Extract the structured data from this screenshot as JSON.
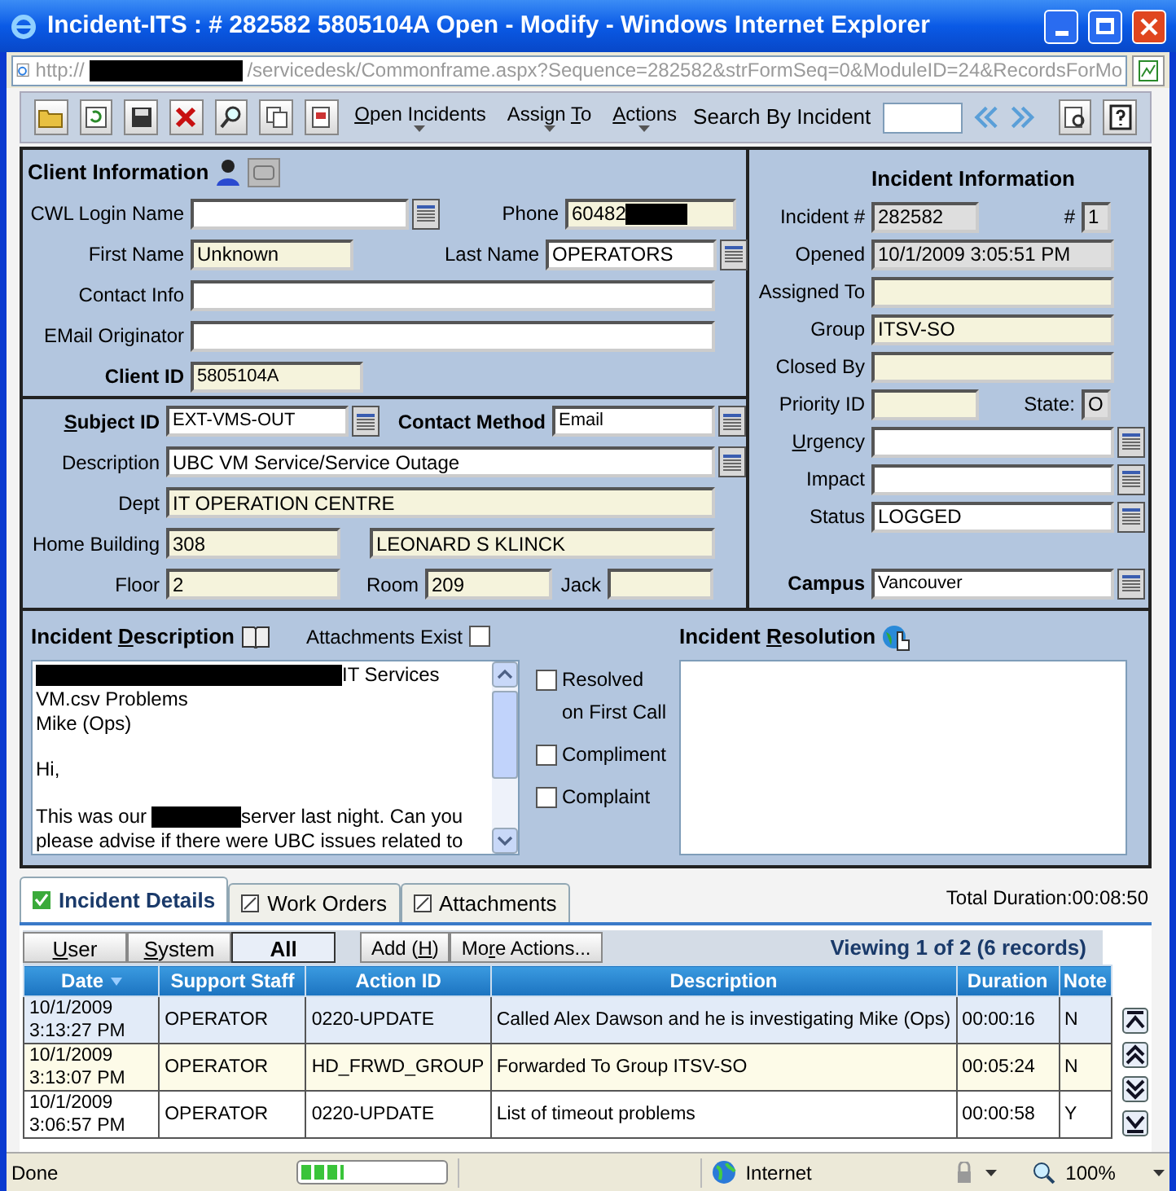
{
  "window": {
    "title": "Incident-ITS : # 282582 5805104A Open - Modify - Windows Internet Explorer"
  },
  "address_bar": {
    "scheme": "http://",
    "path": "/servicedesk/Commonframe.aspx?Sequence=282582&strFormSeq=0&ModuleID=24&RecordsForMo"
  },
  "toolbar": {
    "menus": [
      {
        "parts": {
          "key": "O",
          "after": "pen Incidents"
        }
      },
      {
        "parts": {
          "before": "Assign ",
          "key": "T",
          "after": "o"
        }
      },
      {
        "parts": {
          "key": "A",
          "after": "ctions"
        }
      }
    ],
    "search_label": "Search By Incident"
  },
  "client": {
    "title": "Client Information",
    "cwl_login": {
      "label": "CWL Login Name",
      "kind": "text",
      "lookup": true
    },
    "phone": {
      "label": "Phone",
      "value": "60482",
      "kind": "readonly",
      "lookup": false
    },
    "first_name": {
      "label": "First Name",
      "value": "Unknown",
      "kind": "readonly",
      "lookup": false
    },
    "last_name": {
      "label": "Last Name",
      "value": "OPERATORS",
      "kind": "text",
      "lookup": true
    },
    "contact_info": {
      "label": "Contact Info",
      "kind": "text",
      "lookup": false
    },
    "email_originator": {
      "label": "EMail Originator",
      "kind": "text",
      "lookup": false
    },
    "client_id": {
      "label": "Client ID",
      "value": "5805104A",
      "kind": "readonly",
      "lookup": false
    }
  },
  "subject": {
    "subject_id": {
      "parts": {
        "key": "S",
        "after": "ubject ID"
      },
      "value": "EXT-VMS-OUT",
      "kind": "text",
      "lookup": true
    },
    "contact_method": {
      "label": "Contact Method",
      "value": "Email",
      "kind": "text",
      "lookup": true
    },
    "description": {
      "label": "Description",
      "value": "UBC VM Service/Service Outage",
      "kind": "text",
      "lookup": true
    },
    "dept": {
      "label": "Dept",
      "value": "IT OPERATION CENTRE",
      "kind": "readonly",
      "lookup": false
    },
    "home_building": {
      "label": "Home Building",
      "value": "308",
      "kind": "readonly",
      "lookup": false
    },
    "building_name": {
      "value": "LEONARD S KLINCK",
      "kind": "readonly",
      "lookup": false
    },
    "floor": {
      "label": "Floor",
      "value": "2",
      "kind": "readonly",
      "lookup": false
    },
    "room": {
      "label": "Room",
      "value": "209",
      "kind": "readonly",
      "lookup": false
    },
    "jack": {
      "label": "Jack",
      "kind": "readonly",
      "lookup": false
    }
  },
  "incident": {
    "title": "Incident Information",
    "number": {
      "label": "Incident #",
      "value": "282582",
      "kind": "locked",
      "lookup": false
    },
    "sequence": {
      "label": "#",
      "value": "1",
      "kind": "locked",
      "lookup": false
    },
    "opened": {
      "label": "Opened",
      "value": "10/1/2009 3:05:51 PM",
      "kind": "locked",
      "lookup": false
    },
    "assigned_to": {
      "label": "Assigned To",
      "kind": "readonly",
      "lookup": false
    },
    "group": {
      "label": "Group",
      "value": "ITSV-SO",
      "kind": "readonly",
      "lookup": false
    },
    "closed_by": {
      "label": "Closed By",
      "kind": "readonly",
      "lookup": false
    },
    "priority_id": {
      "label": "Priority ID",
      "kind": "readonly",
      "lookup": false
    },
    "state": {
      "label": "State:",
      "value": "O",
      "kind": "locked",
      "lookup": false
    },
    "urgency": {
      "parts": {
        "key": "U",
        "after": "rgency"
      },
      "kind": "text",
      "lookup": true
    },
    "impact": {
      "label": "Impact",
      "kind": "text",
      "lookup": true
    },
    "status": {
      "label": "Status",
      "value": "LOGGED",
      "kind": "text",
      "lookup": true
    },
    "campus": {
      "label": "Campus",
      "value": "Vancouver",
      "kind": "text",
      "lookup": true
    }
  },
  "description": {
    "title_parts": {
      "before": "Incident ",
      "key": "D",
      "after": "escription"
    },
    "attachments_label": "Attachments Exist",
    "attachments_checked": false,
    "lines": [
      {
        "kind": "redacted_prefix",
        "text": "IT Services"
      },
      {
        "kind": "plain",
        "text": "VM.csv Problems"
      },
      {
        "kind": "plain",
        "text": "Mike (Ops)"
      },
      {
        "kind": "blank"
      },
      {
        "kind": "plain",
        "text": "Hi,"
      },
      {
        "kind": "blank"
      },
      {
        "kind": "redacted_middle",
        "before": "This was our",
        "after": "server last night. Can you"
      },
      {
        "kind": "plain",
        "text": "please advise if there were UBC issues related to"
      }
    ]
  },
  "checkboxes": [
    {
      "label": "Resolved on First Call",
      "checked": false
    },
    {
      "label": "Compliment",
      "checked": false
    },
    {
      "label": "Complaint",
      "checked": false
    }
  ],
  "resolution": {
    "title_parts": {
      "before": "Incident ",
      "key": "R",
      "after": "esolution"
    }
  },
  "tabs": [
    {
      "label": "Incident Details",
      "selected": true
    },
    {
      "label": "Work Orders",
      "selected": false
    },
    {
      "label": "Attachments",
      "selected": false
    }
  ],
  "total_duration": "Total Duration:00:08:50",
  "filters": [
    {
      "parts": {
        "key": "U",
        "after": "ser"
      },
      "selected": false
    },
    {
      "parts": {
        "key": "S",
        "after": "ystem"
      },
      "selected": false
    },
    {
      "parts": {
        "before": "All"
      },
      "selected": true
    }
  ],
  "actions": [
    {
      "parts": {
        "before": "Add (",
        "key": "H",
        "after": ")"
      }
    },
    {
      "parts": {
        "before": "Mo",
        "key": "r",
        "after": "e Actions..."
      }
    }
  ],
  "viewing": "Viewing 1 of 2 (6 records)",
  "table": {
    "columns": [
      {
        "label": "Date",
        "sorted": true
      },
      {
        "label": "Support Staff",
        "sorted": false
      },
      {
        "label": "Action ID",
        "sorted": false
      },
      {
        "label": "Description",
        "sorted": false
      },
      {
        "label": "Duration",
        "sorted": false
      },
      {
        "label": "Note",
        "sorted": false
      }
    ],
    "rows": [
      {
        "selected": true,
        "cells": [
          "10/1/2009 3:13:27 PM",
          "OPERATOR",
          "0220-UPDATE",
          "Called Alex Dawson and he is investigating  Mike (Ops)",
          "00:00:16",
          "N"
        ]
      },
      {
        "selected": false,
        "cells": [
          "10/1/2009 3:13:07 PM",
          "OPERATOR",
          "HD_FRWD_GROUP",
          "Forwarded To Group ITSV-SO",
          "00:05:24",
          "N"
        ]
      },
      {
        "selected": false,
        "cells": [
          "10/1/2009 3:06:57 PM",
          "OPERATOR",
          "0220-UPDATE",
          "List of timeout problems",
          "00:00:58",
          "Y"
        ]
      }
    ]
  },
  "status_bar": {
    "text": "Done",
    "progress": {
      "level": 0.3
    },
    "zone": "Internet",
    "zoom": "100%"
  }
}
